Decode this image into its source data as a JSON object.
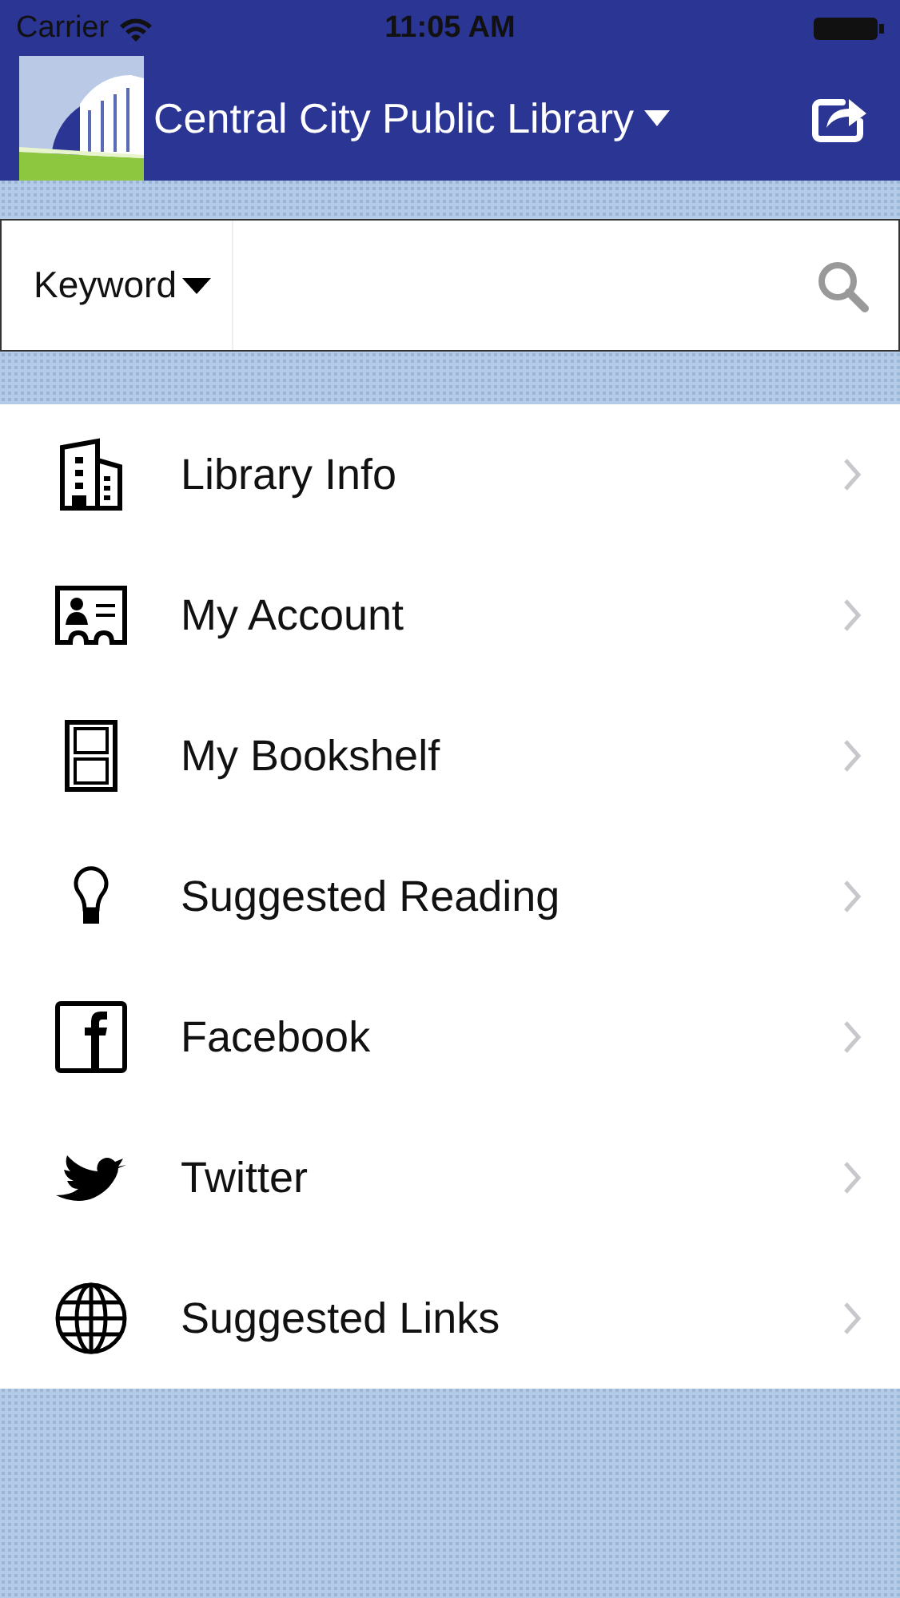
{
  "status_bar": {
    "carrier": "Carrier",
    "time": "11:05 AM"
  },
  "header": {
    "title": "Central City Public Library"
  },
  "search": {
    "scope": "Keyword"
  },
  "menu": [
    {
      "kind": "building",
      "label": "Library Info"
    },
    {
      "kind": "card",
      "label": "My Account"
    },
    {
      "kind": "shelf",
      "label": "My Bookshelf"
    },
    {
      "kind": "bulb",
      "label": "Suggested Reading"
    },
    {
      "kind": "facebook",
      "label": "Facebook"
    },
    {
      "kind": "bird",
      "label": "Twitter"
    },
    {
      "kind": "globe",
      "label": "Suggested Links"
    }
  ]
}
